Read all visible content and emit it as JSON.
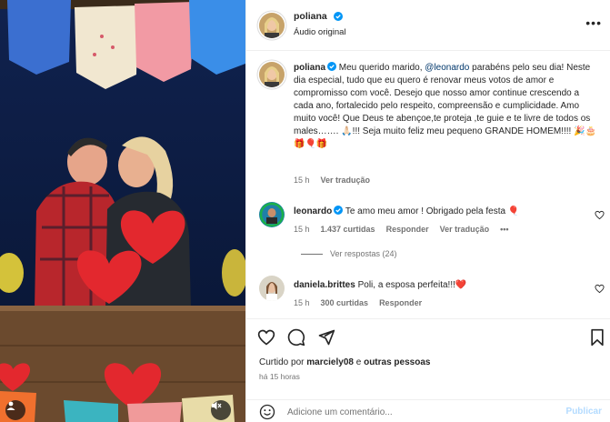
{
  "post": {
    "author": "poliana",
    "audio": "Áudio original"
  },
  "caption": {
    "username": "poliana",
    "text_part1": " Meu querido marido, ",
    "mention": "@leonardo",
    "text_part2": " parabéns pelo seu dia! Neste dia especial, tudo que eu quero é renovar meus votos de amor e compromisso com você. Desejo que nosso amor continue crescendo a cada ano, fortalecido pelo respeito, compreensão e cumplicidade. Amo muito você! Que Deus te abençoe,te proteja ,te guie e te livre de todos os males……. 🙏🏻!!! Seja muito feliz meu pequeno GRANDE HOMEM!!!! 🎉🎂🎁🎈🎁",
    "time": "15 h",
    "see_translation": "Ver tradução"
  },
  "comments": [
    {
      "username": "leonardo",
      "text": "Te amo meu amor ! Obrigado pela festa 🎈",
      "time": "15 h",
      "likes": "1.437 curtidas",
      "reply": "Responder",
      "translate": "Ver tradução",
      "replies_label": "Ver respostas (24)"
    },
    {
      "username": "daniela.brittes",
      "text": "Poli, a esposa perfeita!!!❤️",
      "time": "15 h",
      "likes": "300 curtidas",
      "reply": "Responder"
    }
  ],
  "engagement": {
    "liked_prefix": "Curtido por ",
    "liked_user": "marciely08",
    "liked_mid": " e ",
    "liked_others": "outras pessoas",
    "time_ago": "há 15 horas"
  },
  "comment_box": {
    "placeholder": "Adicione um comentário...",
    "publish": "Publicar"
  },
  "colors": {
    "verified": "#0095f6",
    "link": "#00376b",
    "muted": "#737373",
    "publish_disabled": "#b3dbff"
  },
  "icons": {
    "like": "heart-icon",
    "comment": "comment-icon",
    "share": "paper-plane-icon",
    "save": "bookmark-icon",
    "more": "more-options-icon",
    "emoji": "emoji-icon",
    "verified": "verified-badge-icon"
  }
}
